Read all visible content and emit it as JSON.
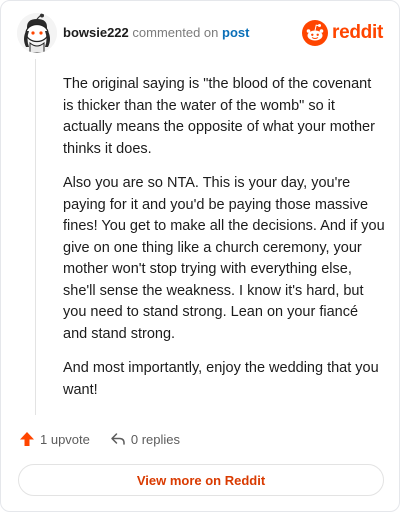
{
  "comment": {
    "username": "bowsie222",
    "action_text": "commented on",
    "post_link": "post",
    "paragraphs": [
      "The original saying is \"the blood of the covenant is thicker than the water of the womb\" so it actually means the opposite of what your mother thinks it does.",
      "Also you are so NTA. This is your day, you're paying for it and you'd be paying those massive fines! You get to make all the decisions. And if you give on one thing like a church ceremony, your mother won't stop trying with everything else, she'll sense the weakness. I know it's hard, but you need to stand strong. Lean on your fiancé and stand strong.",
      "And most importantly, enjoy the wedding that you want!"
    ],
    "upvotes": "1 upvote",
    "replies": "0 replies"
  },
  "brand": {
    "name": "reddit",
    "icon": "reddit-logo-icon",
    "color": "#ff4500"
  },
  "footer": {
    "view_button": "View more on Reddit"
  },
  "colors": {
    "accent": "#ff4500",
    "link": "#0a6fb8",
    "button_text": "#d93a00"
  }
}
